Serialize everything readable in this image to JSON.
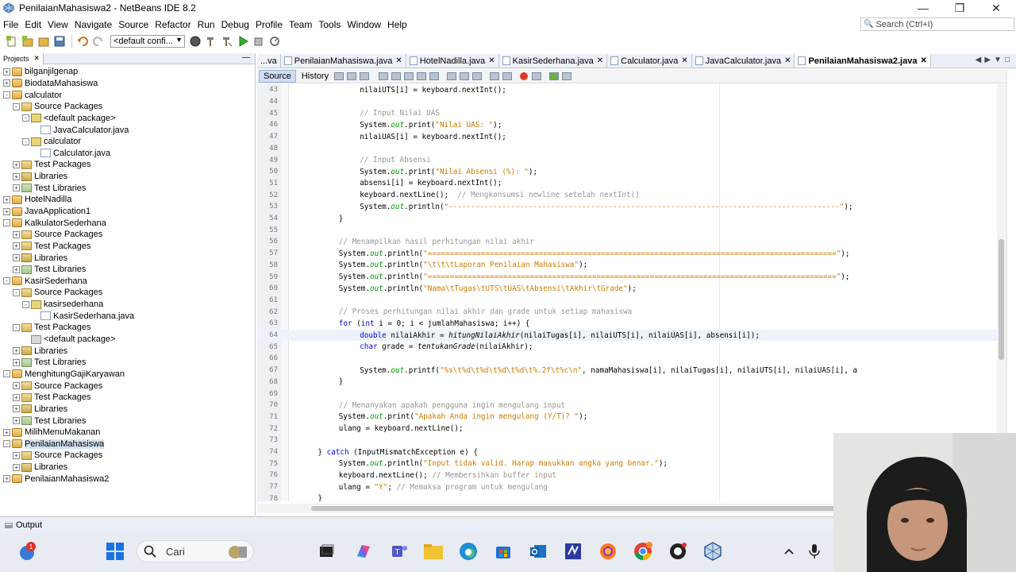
{
  "window": {
    "title": "PenilaianMahasiswa2 - NetBeans IDE 8.2",
    "controls": [
      "minimize",
      "restore",
      "close"
    ]
  },
  "menu": {
    "items": [
      "File",
      "Edit",
      "View",
      "Navigate",
      "Source",
      "Refactor",
      "Run",
      "Debug",
      "Profile",
      "Team",
      "Tools",
      "Window",
      "Help"
    ]
  },
  "search": {
    "placeholder": "Search (Ctrl+I)"
  },
  "toolbar": {
    "config_value": "<default confi..."
  },
  "projects": {
    "tab_label": "Projects",
    "tree": [
      {
        "label": "bilganjilgenap",
        "level": 0,
        "exp": "+",
        "icon": "proj"
      },
      {
        "label": "BiodataMahasiswa",
        "level": 0,
        "exp": "+",
        "icon": "proj"
      },
      {
        "label": "calculator",
        "level": 0,
        "exp": "-",
        "icon": "proj"
      },
      {
        "label": "Source Packages",
        "level": 1,
        "exp": "-",
        "icon": "pkgs"
      },
      {
        "label": "<default package>",
        "level": 2,
        "exp": "-",
        "icon": "pkg"
      },
      {
        "label": "JavaCalculator.java",
        "level": 3,
        "exp": "",
        "icon": "java"
      },
      {
        "label": "calculator",
        "level": 2,
        "exp": "-",
        "icon": "pkg"
      },
      {
        "label": "Calculator.java",
        "level": 3,
        "exp": "",
        "icon": "java"
      },
      {
        "label": "Test Packages",
        "level": 1,
        "exp": "+",
        "icon": "pkgs"
      },
      {
        "label": "Libraries",
        "level": 1,
        "exp": "+",
        "icon": "lib"
      },
      {
        "label": "Test Libraries",
        "level": 1,
        "exp": "+",
        "icon": "tlib"
      },
      {
        "label": "HotelNadilla",
        "level": 0,
        "exp": "+",
        "icon": "proj"
      },
      {
        "label": "JavaApplication1",
        "level": 0,
        "exp": "+",
        "icon": "proj"
      },
      {
        "label": "KalkulatorSederhana",
        "level": 0,
        "exp": "-",
        "icon": "proj"
      },
      {
        "label": "Source Packages",
        "level": 1,
        "exp": "+",
        "icon": "pkgs"
      },
      {
        "label": "Test Packages",
        "level": 1,
        "exp": "+",
        "icon": "pkgs"
      },
      {
        "label": "Libraries",
        "level": 1,
        "exp": "+",
        "icon": "lib"
      },
      {
        "label": "Test Libraries",
        "level": 1,
        "exp": "+",
        "icon": "tlib"
      },
      {
        "label": "KasirSederhana",
        "level": 0,
        "exp": "-",
        "icon": "proj"
      },
      {
        "label": "Source Packages",
        "level": 1,
        "exp": "-",
        "icon": "pkgs"
      },
      {
        "label": "kasirsederhana",
        "level": 2,
        "exp": "-",
        "icon": "pkg"
      },
      {
        "label": "KasirSederhana.java",
        "level": 3,
        "exp": "",
        "icon": "java"
      },
      {
        "label": "Test Packages",
        "level": 1,
        "exp": "-",
        "icon": "pkgs"
      },
      {
        "label": "<default package>",
        "level": 2,
        "exp": "",
        "icon": "gray"
      },
      {
        "label": "Libraries",
        "level": 1,
        "exp": "+",
        "icon": "lib"
      },
      {
        "label": "Test Libraries",
        "level": 1,
        "exp": "+",
        "icon": "tlib"
      },
      {
        "label": "MenghitungGajiKaryawan",
        "level": 0,
        "exp": "-",
        "icon": "proj"
      },
      {
        "label": "Source Packages",
        "level": 1,
        "exp": "+",
        "icon": "pkgs"
      },
      {
        "label": "Test Packages",
        "level": 1,
        "exp": "+",
        "icon": "pkgs"
      },
      {
        "label": "Libraries",
        "level": 1,
        "exp": "+",
        "icon": "lib"
      },
      {
        "label": "Test Libraries",
        "level": 1,
        "exp": "+",
        "icon": "tlib"
      },
      {
        "label": "MilihMenuMakanan",
        "level": 0,
        "exp": "+",
        "icon": "proj"
      },
      {
        "label": "PenilaianMahasiswa",
        "level": 0,
        "exp": "-",
        "icon": "proj",
        "selected": true
      },
      {
        "label": "Source Packages",
        "level": 1,
        "exp": "+",
        "icon": "pkgs"
      },
      {
        "label": "Libraries",
        "level": 1,
        "exp": "+",
        "icon": "lib"
      },
      {
        "label": "PenilaianMahasiswa2",
        "level": 0,
        "exp": "+",
        "icon": "proj"
      }
    ]
  },
  "editor": {
    "tabs": [
      {
        "label": "...va",
        "closable": false,
        "active": false
      },
      {
        "label": "PenilaianMahasiswa.java",
        "closable": true,
        "active": false
      },
      {
        "label": "HotelNadilla.java",
        "closable": true,
        "active": false
      },
      {
        "label": "KasirSederhana.java",
        "closable": true,
        "active": false
      },
      {
        "label": "Calculator.java",
        "closable": true,
        "active": false
      },
      {
        "label": "JavaCalculator.java",
        "closable": true,
        "active": false
      },
      {
        "label": "PenilaianMahasiswa2.java",
        "closable": true,
        "active": true
      }
    ],
    "source_label": "Source",
    "history_label": "History",
    "current_line": 64,
    "lines": [
      {
        "n": "43",
        "indent": 12,
        "parts": [
          [
            "",
            "nilaiUTS[i] = keyboard.nextInt();"
          ]
        ]
      },
      {
        "n": "44",
        "indent": 0,
        "parts": []
      },
      {
        "n": "45",
        "indent": 12,
        "parts": [
          [
            "cm",
            "// Input Nilai UAS"
          ]
        ]
      },
      {
        "n": "46",
        "indent": 12,
        "parts": [
          [
            "",
            "System."
          ],
          [
            "fld",
            "out"
          ],
          [
            "",
            ".print("
          ],
          [
            "str",
            "\"Nilai UAS: \""
          ],
          [
            "",
            ");"
          ]
        ]
      },
      {
        "n": "47",
        "indent": 12,
        "parts": [
          [
            "",
            "nilaiUAS[i] = keyboard.nextInt();"
          ]
        ]
      },
      {
        "n": "48",
        "indent": 0,
        "parts": []
      },
      {
        "n": "49",
        "indent": 12,
        "parts": [
          [
            "cm",
            "// Input Absensi"
          ]
        ]
      },
      {
        "n": "50",
        "indent": 12,
        "parts": [
          [
            "",
            "System."
          ],
          [
            "fld",
            "out"
          ],
          [
            "",
            ".print("
          ],
          [
            "str",
            "\"Nilai Absensi (%): \""
          ],
          [
            "",
            ");"
          ]
        ]
      },
      {
        "n": "51",
        "indent": 12,
        "parts": [
          [
            "",
            "absensi[i] = keyboard.nextInt();"
          ]
        ]
      },
      {
        "n": "52",
        "indent": 12,
        "parts": [
          [
            "",
            "keyboard.nextLine();  "
          ],
          [
            "cm",
            "// Mengkonsumsi newline setelah nextInt()"
          ]
        ]
      },
      {
        "n": "53",
        "indent": 12,
        "parts": [
          [
            "",
            "System."
          ],
          [
            "fld",
            "out"
          ],
          [
            "",
            ".println("
          ],
          [
            "str",
            "\"----------------------------------------------------------------------------------------\""
          ],
          [
            "",
            ");"
          ]
        ]
      },
      {
        "n": "54",
        "indent": 8,
        "parts": [
          [
            "",
            "}"
          ]
        ]
      },
      {
        "n": "55",
        "indent": 0,
        "parts": []
      },
      {
        "n": "56",
        "indent": 8,
        "parts": [
          [
            "cm",
            "// Menampilkan hasil perhitungan nilai akhir"
          ]
        ]
      },
      {
        "n": "57",
        "indent": 8,
        "parts": [
          [
            "",
            "System."
          ],
          [
            "fld",
            "out"
          ],
          [
            "",
            ".println("
          ],
          [
            "str",
            "\"============================================================================================\""
          ],
          [
            "",
            ");"
          ]
        ]
      },
      {
        "n": "58",
        "indent": 8,
        "parts": [
          [
            "",
            "System."
          ],
          [
            "fld",
            "out"
          ],
          [
            "",
            ".println("
          ],
          [
            "str",
            "\"\\t\\t\\tLaporan Penilaian Mahasiswa\""
          ],
          [
            "",
            ");"
          ]
        ]
      },
      {
        "n": "59",
        "indent": 8,
        "parts": [
          [
            "",
            "System."
          ],
          [
            "fld",
            "out"
          ],
          [
            "",
            ".println("
          ],
          [
            "str",
            "\"============================================================================================\""
          ],
          [
            "",
            ");"
          ]
        ]
      },
      {
        "n": "60",
        "indent": 8,
        "parts": [
          [
            "",
            "System."
          ],
          [
            "fld",
            "out"
          ],
          [
            "",
            ".println("
          ],
          [
            "str",
            "\"Nama\\tTugas\\tUTS\\tUAS\\tAbsensi\\tAkhir\\tGrade\""
          ],
          [
            "",
            ");"
          ]
        ]
      },
      {
        "n": "61",
        "indent": 0,
        "parts": []
      },
      {
        "n": "62",
        "indent": 8,
        "parts": [
          [
            "cm",
            "// Proses perhitungan nilai akhir dan grade untuk setiap mahasiswa"
          ]
        ]
      },
      {
        "n": "63",
        "indent": 8,
        "parts": [
          [
            "kw",
            "for"
          ],
          [
            "",
            " ("
          ],
          [
            "kw",
            "int"
          ],
          [
            "",
            " i = 0; i < jumlahMahasiswa; i++) {"
          ]
        ]
      },
      {
        "n": "64",
        "indent": 12,
        "parts": [
          [
            "kw",
            "double"
          ],
          [
            "",
            " nilaiAkhir = "
          ],
          [
            "mtd",
            "hitungNilaiAkhir"
          ],
          [
            "",
            "(nilaiTugas[i], nilaiUTS[i], nilaiUAS[i], absensi[i]);"
          ]
        ]
      },
      {
        "n": "65",
        "indent": 12,
        "parts": [
          [
            "kw",
            "char"
          ],
          [
            "",
            " grade = "
          ],
          [
            "mtd",
            "tentukanGrade"
          ],
          [
            "",
            "(nilaiAkhir);"
          ]
        ]
      },
      {
        "n": "66",
        "indent": 0,
        "parts": []
      },
      {
        "n": "67",
        "indent": 12,
        "parts": [
          [
            "",
            "System."
          ],
          [
            "fld",
            "out"
          ],
          [
            "",
            ".printf("
          ],
          [
            "str",
            "\"%s\\t%d\\t%d\\t%d\\t%d\\t%.2f\\t%c\\n\""
          ],
          [
            "",
            ", namaMahasiswa[i], nilaiTugas[i], nilaiUTS[i], nilaiUAS[i], a"
          ]
        ]
      },
      {
        "n": "68",
        "indent": 8,
        "parts": [
          [
            "",
            "}"
          ]
        ]
      },
      {
        "n": "69",
        "indent": 0,
        "parts": []
      },
      {
        "n": "70",
        "indent": 8,
        "parts": [
          [
            "cm",
            "// Menanyakan apakah pengguna ingin mengulang input"
          ]
        ]
      },
      {
        "n": "71",
        "indent": 8,
        "parts": [
          [
            "",
            "System."
          ],
          [
            "fld",
            "out"
          ],
          [
            "",
            ".print("
          ],
          [
            "str",
            "\"Apakah Anda ingin mengulang (Y/T)? \""
          ],
          [
            "",
            ");"
          ]
        ]
      },
      {
        "n": "72",
        "indent": 8,
        "parts": [
          [
            "",
            "ulang = keyboard.nextLine();"
          ]
        ]
      },
      {
        "n": "73",
        "indent": 0,
        "parts": []
      },
      {
        "n": "74",
        "indent": 4,
        "parts": [
          [
            "",
            "} "
          ],
          [
            "kw",
            "catch"
          ],
          [
            "",
            " (InputMismatchException e) {"
          ]
        ]
      },
      {
        "n": "75",
        "indent": 8,
        "parts": [
          [
            "",
            "System."
          ],
          [
            "fld",
            "out"
          ],
          [
            "",
            ".println("
          ],
          [
            "str",
            "\"Input tidak valid. Harap masukkan angka yang benar.\""
          ],
          [
            "",
            ");"
          ]
        ]
      },
      {
        "n": "76",
        "indent": 8,
        "parts": [
          [
            "",
            "keyboard.nextLine(); "
          ],
          [
            "cm",
            "// Membersihkan buffer input"
          ]
        ]
      },
      {
        "n": "77",
        "indent": 8,
        "parts": [
          [
            "",
            "ulang = "
          ],
          [
            "str",
            "\"Y\""
          ],
          [
            "",
            "; "
          ],
          [
            "cm",
            "// Memaksa program untuk mengulang"
          ]
        ]
      },
      {
        "n": "78",
        "indent": 4,
        "parts": [
          [
            "",
            "}"
          ]
        ]
      }
    ]
  },
  "output": {
    "label": "Output"
  },
  "taskbar": {
    "search_label": "Cari",
    "notification_count": "1",
    "colors": {
      "accent": "#1a73e8"
    }
  }
}
